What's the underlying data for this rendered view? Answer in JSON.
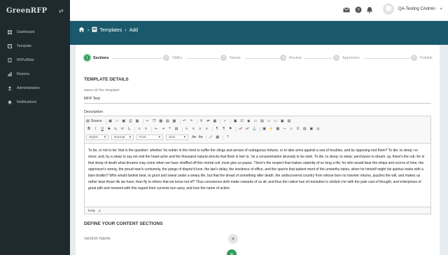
{
  "sidebar": {
    "logo": "GreenRFP",
    "items": [
      {
        "label": "Dashboard",
        "icon": "dashboard-icon"
      },
      {
        "label": "Template",
        "icon": "template-icon"
      },
      {
        "label": "RFPs/Bids",
        "icon": "rfps-icon"
      },
      {
        "label": "Reports",
        "icon": "reports-icon"
      },
      {
        "label": "Administration",
        "icon": "administration-icon"
      },
      {
        "label": "Notifications",
        "icon": "notifications-icon"
      }
    ]
  },
  "topbar": {
    "user_name": "QA-Testing CAdmin",
    "icons": [
      "mail-icon",
      "help-icon",
      "bell-icon"
    ]
  },
  "breadcrumb": {
    "home_icon": "home-icon",
    "section_icon": "template-icon",
    "section": "Templates",
    "current": "Add"
  },
  "stepper": [
    {
      "num": "1",
      "label": "Sections",
      "active": true
    },
    {
      "num": "2",
      "label": "SMEs",
      "active": false
    },
    {
      "num": "3",
      "label": "Needs",
      "active": false
    },
    {
      "num": "4",
      "label": "Review",
      "active": false
    },
    {
      "num": "5",
      "label": "Approvers",
      "active": false
    },
    {
      "num": "6",
      "label": "Publish",
      "active": false
    }
  ],
  "form": {
    "template_details_title": "TEMPLATE DETAILS",
    "name_label": "Name Of The Template",
    "name_required": "*",
    "name_value": "RFP Test",
    "description_label": "Description",
    "description_text": "To be, or not to be: that is the question: whether 'tis nobler in the mind to suffer the slings and arrows of outrageous fortune, or to take arms against a sea of troubles, and by opposing end them? To die: to sleep; no more; and, by a sleep to say we end the heart-ache and the thousand natural shocks that flesh is heir to, 'tis a consummation devoutly to be wish. To die, to sleep; to sleep: perchance to dream: ay, there's the rub; for in that sleep of death what dreams may come when we have shuffled off this mortal coil, must give us pause. There's the respect that makes calamity of so long a life; for who would bear the whips and scorns of time, the oppressor's wrong, the proud man's contumely, the pangs of dispriz'd love, the law's delay, the insolence of office, and the spurns that patient merit of the unworthy takes, when he himself might his quietus make with a bare bodkin? Who would fardels bear, to grunt and sweat under a weary life, but that the dread of something after death, the undiscovered country from whose born no traveler returns, puzzles the will, and makes us rather bear those ills we have, than fly to others that we know not of? Thus conscience doth make cowards of us all; and thus the native hue of resolution is sickled o'er with the pale cast of thought, and enterprises of great pith and moment with this regard their currents turn awry, and lose the name of action.",
    "editor_path": [
      "body",
      "p"
    ],
    "content_sections_title": "DEFINE YOUR CONTENT SECTIONS",
    "section_name_placeholder": "Section Name"
  },
  "editor_toolbar": {
    "source_label": "Source",
    "styles_label": "Styles",
    "format_label": "Normal",
    "font_label": "Font",
    "size_label": "Size"
  },
  "colors": {
    "sidebar": "#1e2a2e",
    "header_band": "#19596b",
    "accent_green": "#2e9e5a"
  }
}
